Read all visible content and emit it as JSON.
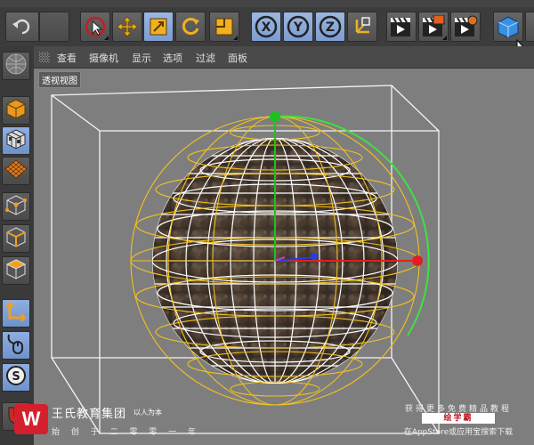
{
  "viewport_menu": {
    "items": [
      "查看",
      "摄像机",
      "显示",
      "选项",
      "过滤",
      "面板"
    ]
  },
  "viewport": {
    "label": "透视视图"
  },
  "icons": {
    "toolbar": [
      "undo-icon",
      "select-icon",
      "move-icon",
      "scale-icon",
      "rotate-icon",
      "snap-icon",
      "x-axis-icon",
      "y-axis-icon",
      "z-axis-icon",
      "coordinate-system-icon",
      "render-view-icon",
      "render-picture-viewer-icon",
      "render-settings-icon",
      "cube-primitive-icon"
    ],
    "left": [
      "sphere-object-icon",
      "model-mode-icon",
      "texture-mode-icon",
      "workplane-icon",
      "points-mode-icon",
      "edges-mode-icon",
      "polygons-mode-icon",
      "axis-mode-icon",
      "tweak-mode-icon",
      "snap-mode-icon",
      "magnet-icon"
    ]
  },
  "watermark_left": {
    "logo": "W",
    "name": "王氏教育集团",
    "slogan_small": "以人为本",
    "tagline": "始 创 于 二 零 零 一 年"
  },
  "watermark_right": {
    "line1": "获得更多免费精品教程",
    "badge": "绘学霸",
    "line3": "在AppStore或应用宝搜索下载"
  },
  "colors": {
    "ui_background": "#3a3a3a",
    "viewport_background": "#7e7e7e",
    "active_tool": "#8fb0e2",
    "yellow_wire": "#f0c020",
    "x_axis": "#e02020",
    "y_axis": "#20c020",
    "z_axis": "#2040e0"
  }
}
